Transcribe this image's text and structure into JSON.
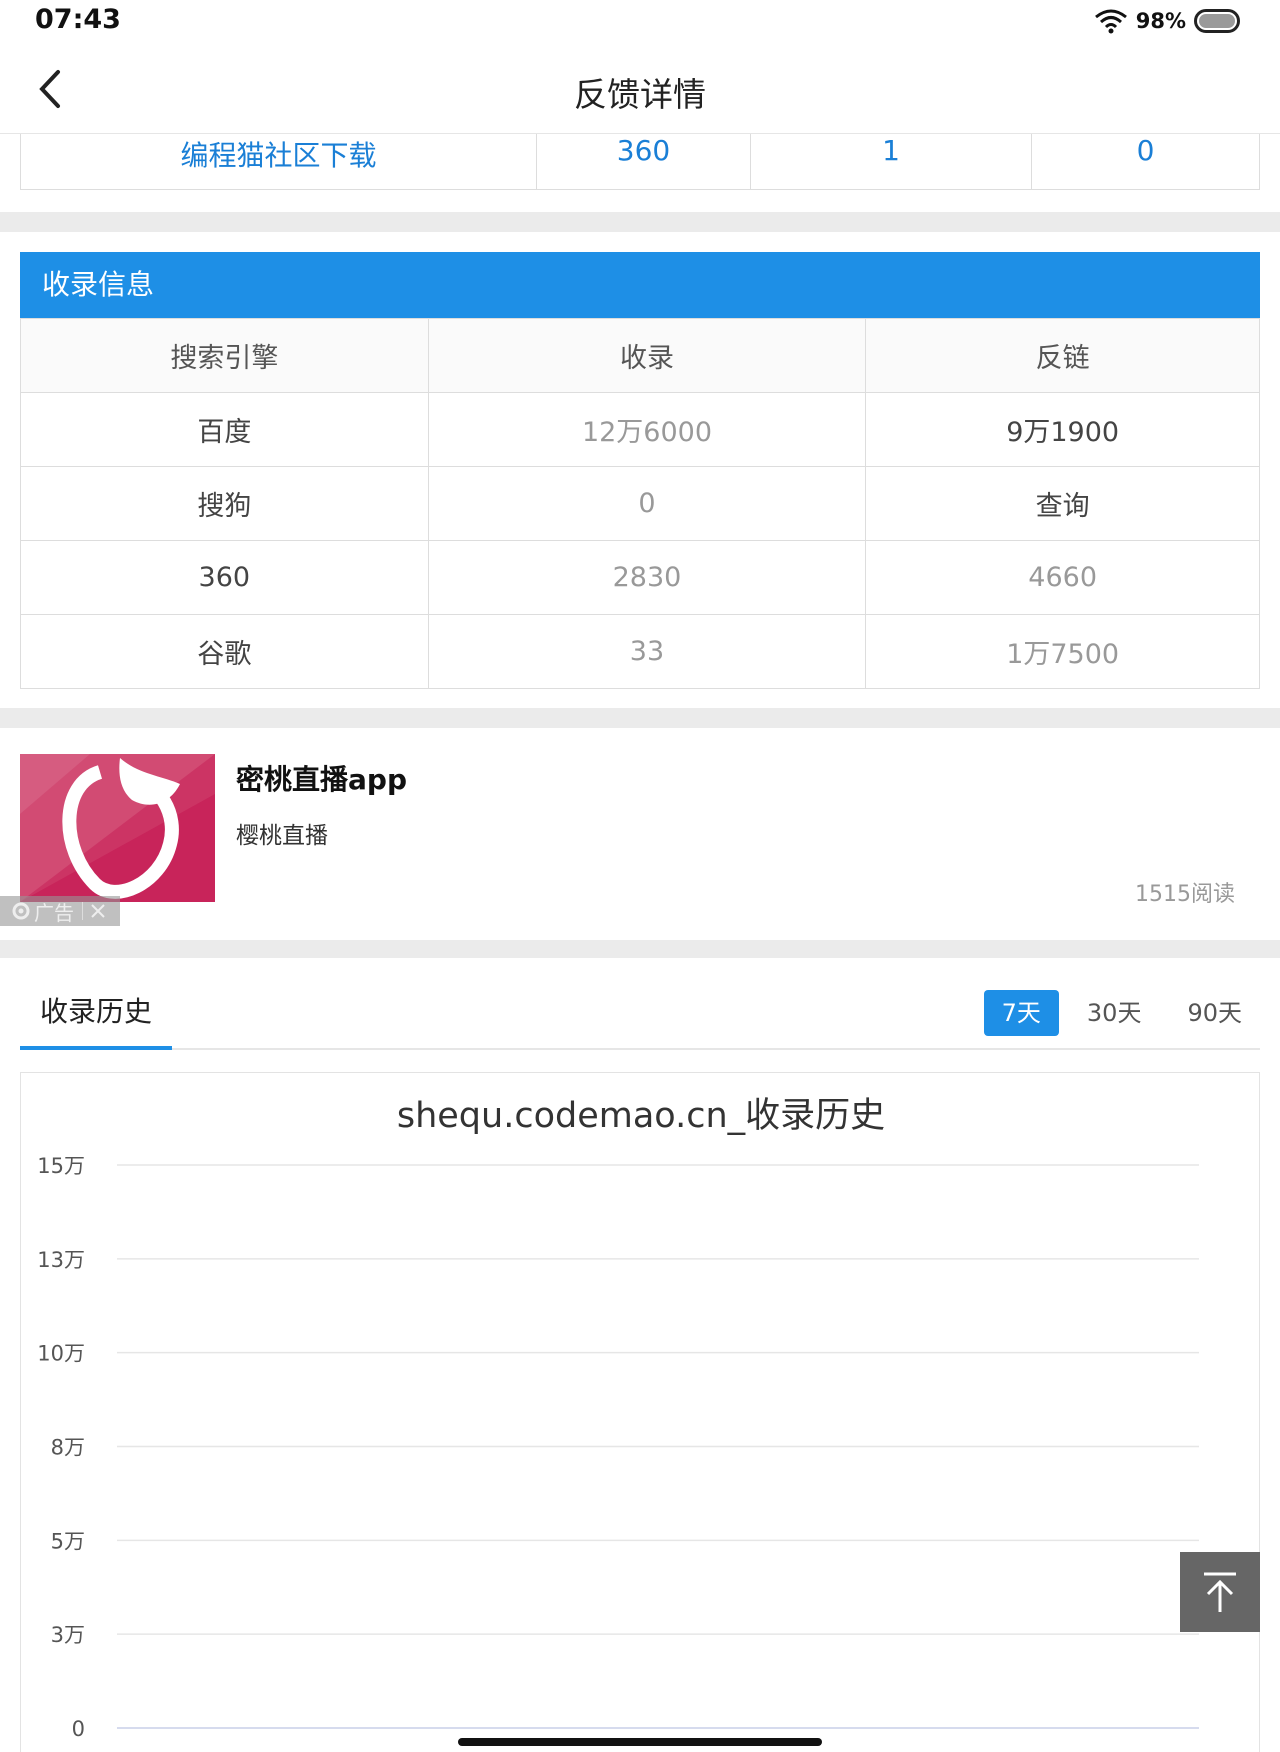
{
  "status_bar": {
    "time": "07:43",
    "battery": "98%"
  },
  "header": {
    "title": "反馈详情"
  },
  "top_table": {
    "cells": [
      "编程猫社区下载",
      "360",
      "1",
      "0"
    ]
  },
  "index_info": {
    "title": "收录信息",
    "columns": [
      "搜索引擎",
      "收录",
      "反链"
    ],
    "rows": [
      [
        "百度",
        "12万6000",
        "9万1900"
      ],
      [
        "搜狗",
        "0",
        "查询"
      ],
      [
        "360",
        "2830",
        "4660"
      ],
      [
        "谷歌",
        "33",
        "1万7500"
      ]
    ],
    "link_color": "#333333"
  },
  "ad": {
    "title": "密桃直播app",
    "subtitle": "樱桃直播",
    "reads": "1515阅读",
    "badge": "广告"
  },
  "history": {
    "tab": "收录历史",
    "ranges": [
      "7天",
      "30天",
      "90天"
    ],
    "active_range": "7天"
  },
  "chart_data": {
    "type": "line",
    "title": "shequ.codemao.cn_收录历史",
    "y_ticks": [
      "15万",
      "13万",
      "10万",
      "8万",
      "5万",
      "3万",
      "0"
    ],
    "ylim": [
      0,
      150000
    ],
    "grid": true,
    "x": [],
    "series": []
  },
  "colors": {
    "accent": "#1e8fe6",
    "link": "#1a7fd6",
    "band": "#ebebeb"
  }
}
